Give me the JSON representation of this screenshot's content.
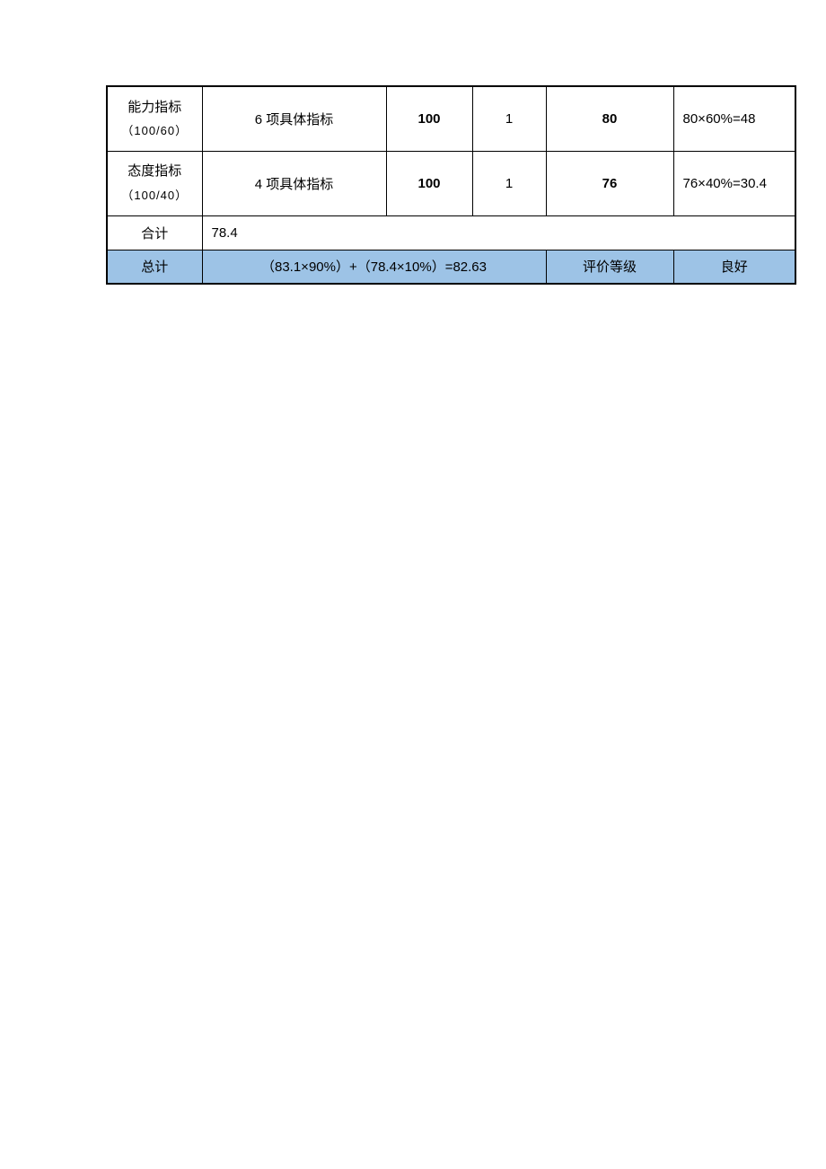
{
  "rows": [
    {
      "label_line1": "能力指标",
      "label_line2": "（100/60）",
      "desc": "6 项具体指标",
      "max": "100",
      "weight": "1",
      "score": "80",
      "calc": "80×60%=48"
    },
    {
      "label_line1": "态度指标",
      "label_line2": "（100/40）",
      "desc": "4 项具体指标",
      "max": "100",
      "weight": "1",
      "score": "76",
      "calc": "76×40%=30.4"
    }
  ],
  "subtotal": {
    "label": "合计",
    "value": "78.4"
  },
  "total": {
    "label": "总计",
    "formula": "（83.1×90%）+（78.4×10%）=82.63",
    "grade_label": "评价等级",
    "grade_value": "良好"
  }
}
